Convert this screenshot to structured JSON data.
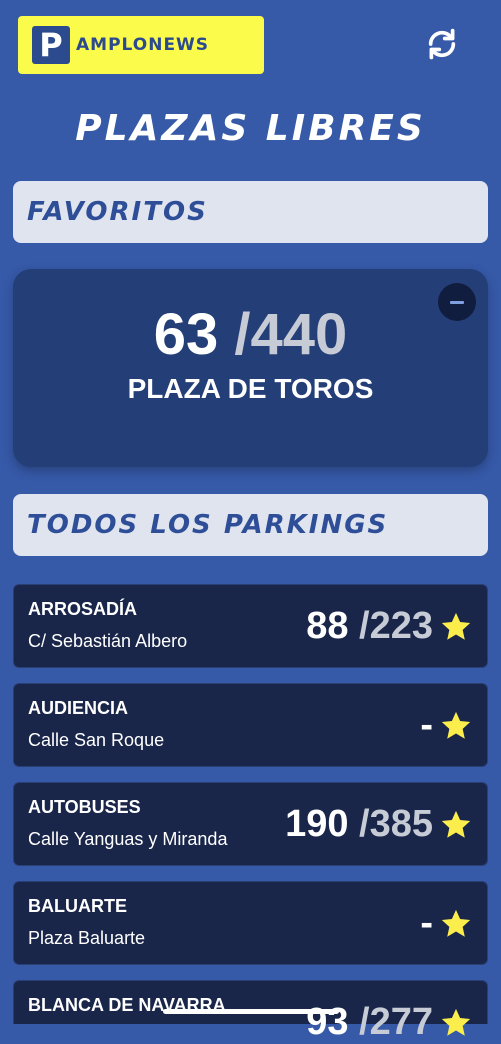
{
  "app": {
    "logo_letter": "P",
    "logo_text": "AMPLONEWS",
    "title": "PLAZAS LIBRES"
  },
  "sections": {
    "favorites_label": "FAVORITOS",
    "all_label": "TODOS LOS PARKINGS"
  },
  "favorite": {
    "free": "63",
    "total": "/440",
    "name": "PLAZA DE TOROS"
  },
  "parkings": [
    {
      "name": "ARROSADÍA",
      "address": "C/ Sebastián Albero",
      "free": "88",
      "total": "/223"
    },
    {
      "name": "AUDIENCIA",
      "address": "Calle San Roque",
      "free": "-",
      "total": ""
    },
    {
      "name": "AUTOBUSES",
      "address": "Calle Yanguas y Miranda",
      "free": "190",
      "total": "/385"
    },
    {
      "name": "BALUARTE",
      "address": "Plaza Baluarte",
      "free": "-",
      "total": ""
    },
    {
      "name": "BLANCA DE NAVARRA",
      "address": "",
      "free": "93",
      "total": "/277"
    }
  ],
  "icons": {
    "refresh": "refresh-icon",
    "star": "star-icon",
    "remove": "minus-icon"
  },
  "colors": {
    "background": "#3659a8",
    "logo_bg": "#fbfb4c",
    "card_bg": "#19264a",
    "star": "#fbee4c"
  }
}
